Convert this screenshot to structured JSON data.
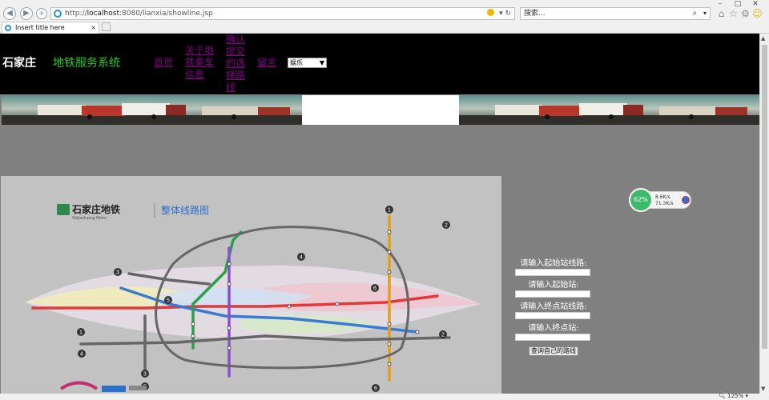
{
  "browser": {
    "window_buttons": [
      "–",
      "□",
      "✕"
    ],
    "url_prefix": "http://",
    "url_host": "localhost",
    "url_rest": ":8080/lianxia/showline.jsp",
    "address_tools": "▾ ↻",
    "search_placeholder": "搜索...",
    "tab_title": "Insert title here",
    "tab_close": "×",
    "zoom": "125%",
    "icons": [
      "back-icon",
      "forward-icon",
      "compat-view-icon",
      "refresh-icon",
      "search-icon",
      "home-icon",
      "favorites-icon",
      "settings-icon",
      "smiley-icon"
    ]
  },
  "header": {
    "brand": "石家庄",
    "subtitle": "地铁服务系统",
    "nav": {
      "home": "首页",
      "about": "关于地铁乘车信息",
      "submit": "确认提交的选择路线",
      "message": "留言"
    },
    "category_selected": "娱乐"
  },
  "map": {
    "title_cn": "石家庄地铁",
    "title_en": "Shijiazhuang Metro",
    "subtitle": "整体线路图",
    "line_numbers": [
      "1",
      "2",
      "3",
      "4",
      "5",
      "6"
    ],
    "colors": {
      "line1": "#e03a3a",
      "line2": "#3a7ad0",
      "line3": "#2aa04a",
      "line4": "#8a4fd0",
      "line5": "#e0a020",
      "line6": "#5a5a5a",
      "track": "#666666"
    }
  },
  "form": {
    "start_line_label": "请输入起始站线路:",
    "start_station_label": "请输入起始站:",
    "end_line_label": "请输入终点站线路:",
    "end_station_label": "请输入终点站:",
    "submit_label": "查询自己的路线"
  },
  "net_widget": {
    "percent": "62%",
    "upload": "8.6K/s",
    "download": "71.3K/s"
  }
}
